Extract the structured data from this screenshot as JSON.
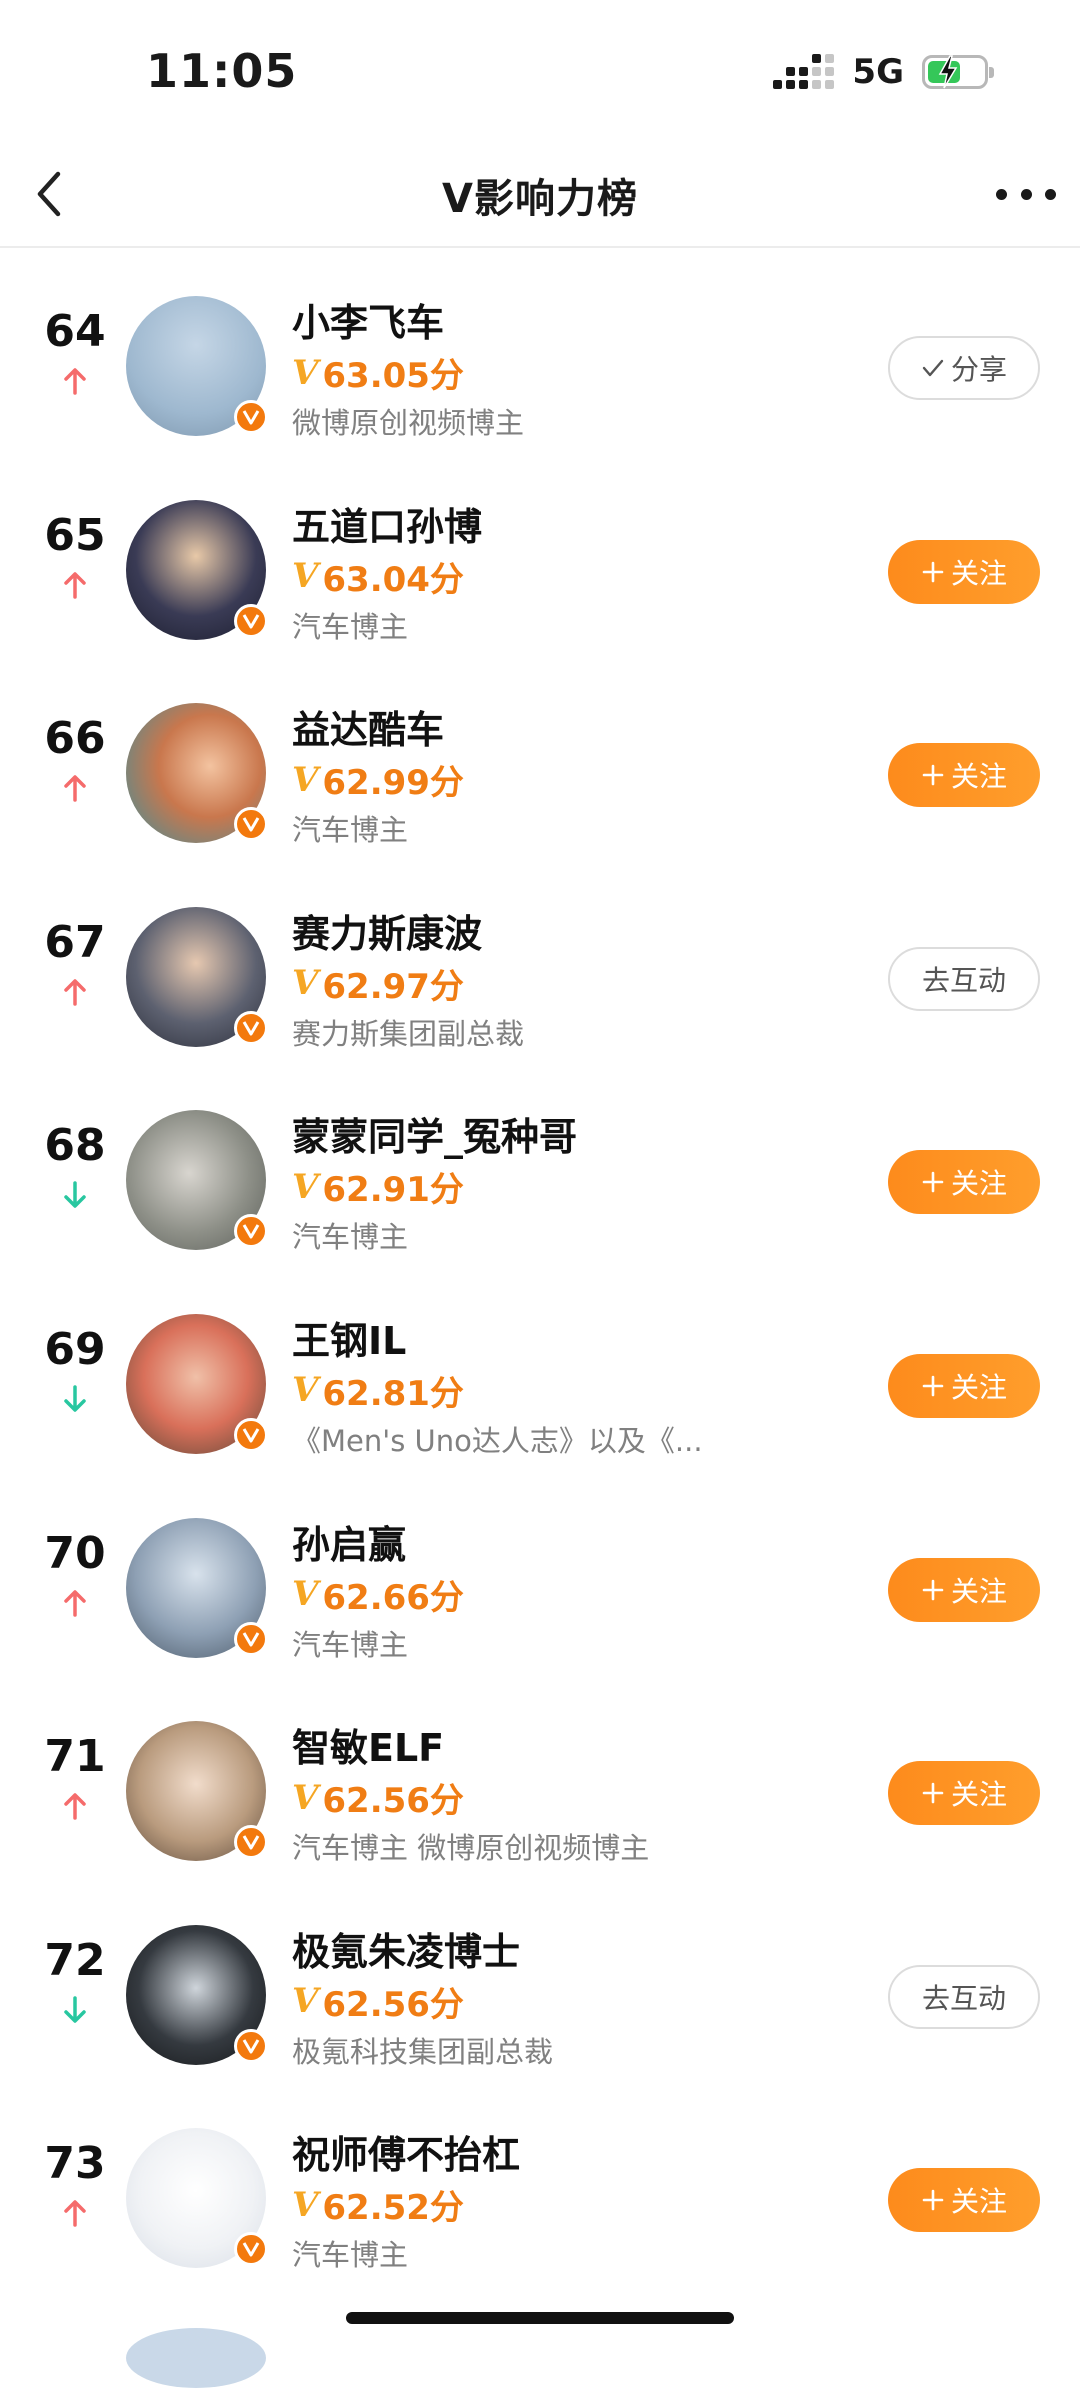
{
  "status_bar": {
    "time": "11:05",
    "network": "5G",
    "battery_color": "#35c759"
  },
  "nav": {
    "title": "V影响力榜",
    "back_icon": "chevron-left-icon",
    "more_icon": "more-horizontal-icon"
  },
  "colors": {
    "accent": "#f07d14",
    "follow_button": "#fd8b1c",
    "trend_up": "#f56b6b",
    "trend_down": "#28c7a0"
  },
  "rows": [
    {
      "rank": "64",
      "trend": "up",
      "name": "小李飞车",
      "score": "63.05分",
      "desc": "微博原创视频博主",
      "button": {
        "type": "outline",
        "label": "分享",
        "icon": "check-icon"
      }
    },
    {
      "rank": "65",
      "trend": "up",
      "name": "五道口孙博",
      "score": "63.04分",
      "desc": "汽车博主",
      "button": {
        "type": "follow",
        "label": "关注",
        "icon": "plus-icon"
      }
    },
    {
      "rank": "66",
      "trend": "up",
      "name": "益达酷车",
      "score": "62.99分",
      "desc": "汽车博主",
      "button": {
        "type": "follow",
        "label": "关注",
        "icon": "plus-icon"
      }
    },
    {
      "rank": "67",
      "trend": "up",
      "name": "赛力斯康波",
      "score": "62.97分",
      "desc": "赛力斯集团副总裁",
      "button": {
        "type": "outline",
        "label": "去互动",
        "icon": ""
      }
    },
    {
      "rank": "68",
      "trend": "down",
      "name": "蒙蒙同学_冤种哥",
      "score": "62.91分",
      "desc": "汽车博主",
      "button": {
        "type": "follow",
        "label": "关注",
        "icon": "plus-icon"
      }
    },
    {
      "rank": "69",
      "trend": "down",
      "name": "王钢IL",
      "score": "62.81分",
      "desc": "《Men's Uno达人志》以及《...",
      "button": {
        "type": "follow",
        "label": "关注",
        "icon": "plus-icon"
      }
    },
    {
      "rank": "70",
      "trend": "up",
      "name": "孙启赢",
      "score": "62.66分",
      "desc": "汽车博主",
      "button": {
        "type": "follow",
        "label": "关注",
        "icon": "plus-icon"
      }
    },
    {
      "rank": "71",
      "trend": "up",
      "name": "智敏ELF",
      "score": "62.56分",
      "desc": "汽车博主 微博原创视频博主",
      "button": {
        "type": "follow",
        "label": "关注",
        "icon": "plus-icon"
      }
    },
    {
      "rank": "72",
      "trend": "down",
      "name": "极氪朱凌博士",
      "score": "62.56分",
      "desc": "极氪科技集团副总裁",
      "button": {
        "type": "outline",
        "label": "去互动",
        "icon": ""
      }
    },
    {
      "rank": "73",
      "trend": "up",
      "name": "祝师傅不抬杠",
      "score": "62.52分",
      "desc": "汽车博主",
      "button": {
        "type": "follow",
        "label": "关注",
        "icon": "plus-icon"
      }
    }
  ]
}
